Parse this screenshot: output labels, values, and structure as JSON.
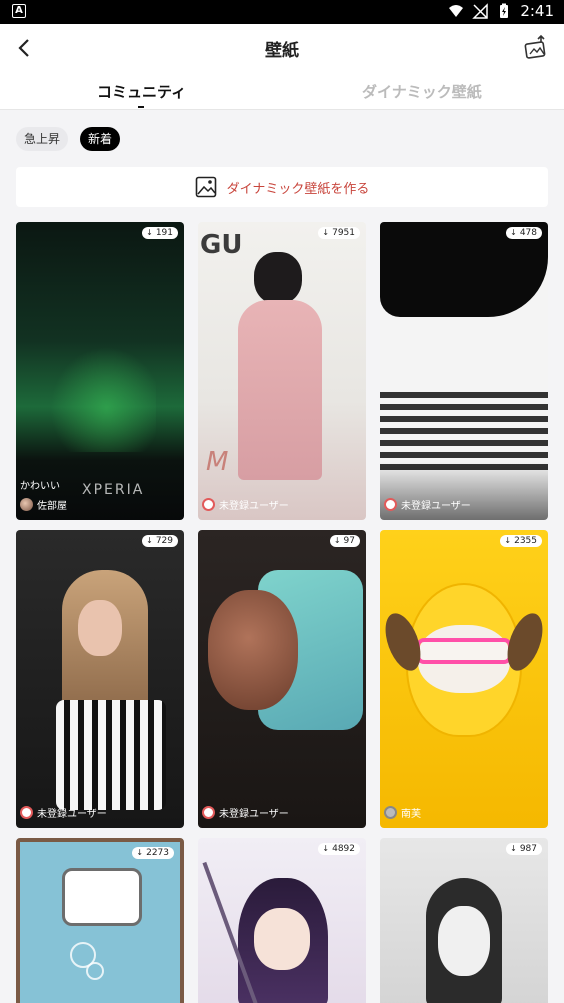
{
  "status_bar": {
    "left_badge": "A",
    "time": "2:41"
  },
  "header": {
    "title": "壁紙"
  },
  "tabs": [
    {
      "label": "コミュニティ",
      "active": true
    },
    {
      "label": "ダイナミック壁紙",
      "active": false
    }
  ],
  "filters": [
    {
      "label": "急上昇",
      "selected": false
    },
    {
      "label": "新着",
      "selected": true
    }
  ],
  "create_button": {
    "label": "ダイナミック壁紙を作る",
    "icon": "image-icon"
  },
  "colors": {
    "accent": "#c8453c"
  },
  "cards": [
    {
      "count": "191",
      "user": "佐部屋",
      "caption": "かわいい",
      "watermark": "XPERIA"
    },
    {
      "count": "7951",
      "user": "未登録ユーザー"
    },
    {
      "count": "478",
      "user": "未登録ユーザー"
    },
    {
      "count": "729",
      "user": "未登録ユーザー"
    },
    {
      "count": "97",
      "user": "未登録ユーザー"
    },
    {
      "count": "2355",
      "user": "南芙"
    },
    {
      "count": "2273"
    },
    {
      "count": "4892"
    },
    {
      "count": "987"
    }
  ]
}
